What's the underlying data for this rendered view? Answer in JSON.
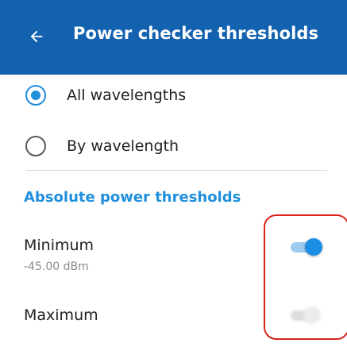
{
  "app_bar": {
    "back_icon": "arrow-left-icon",
    "title": "Power checker thresholds"
  },
  "mode_options": [
    {
      "label": "All wavelengths",
      "selected": true
    },
    {
      "label": "By wavelength",
      "selected": false
    }
  ],
  "section": {
    "title": "Absolute power thresholds"
  },
  "settings": {
    "minimum": {
      "title": "Minimum",
      "value": "-45.00 dBm",
      "enabled": true
    },
    "maximum": {
      "title": "Maximum",
      "enabled": false
    }
  },
  "colors": {
    "app_bar": "#1362b0",
    "accent": "#1f8fdc",
    "highlight": "#d6241c"
  }
}
